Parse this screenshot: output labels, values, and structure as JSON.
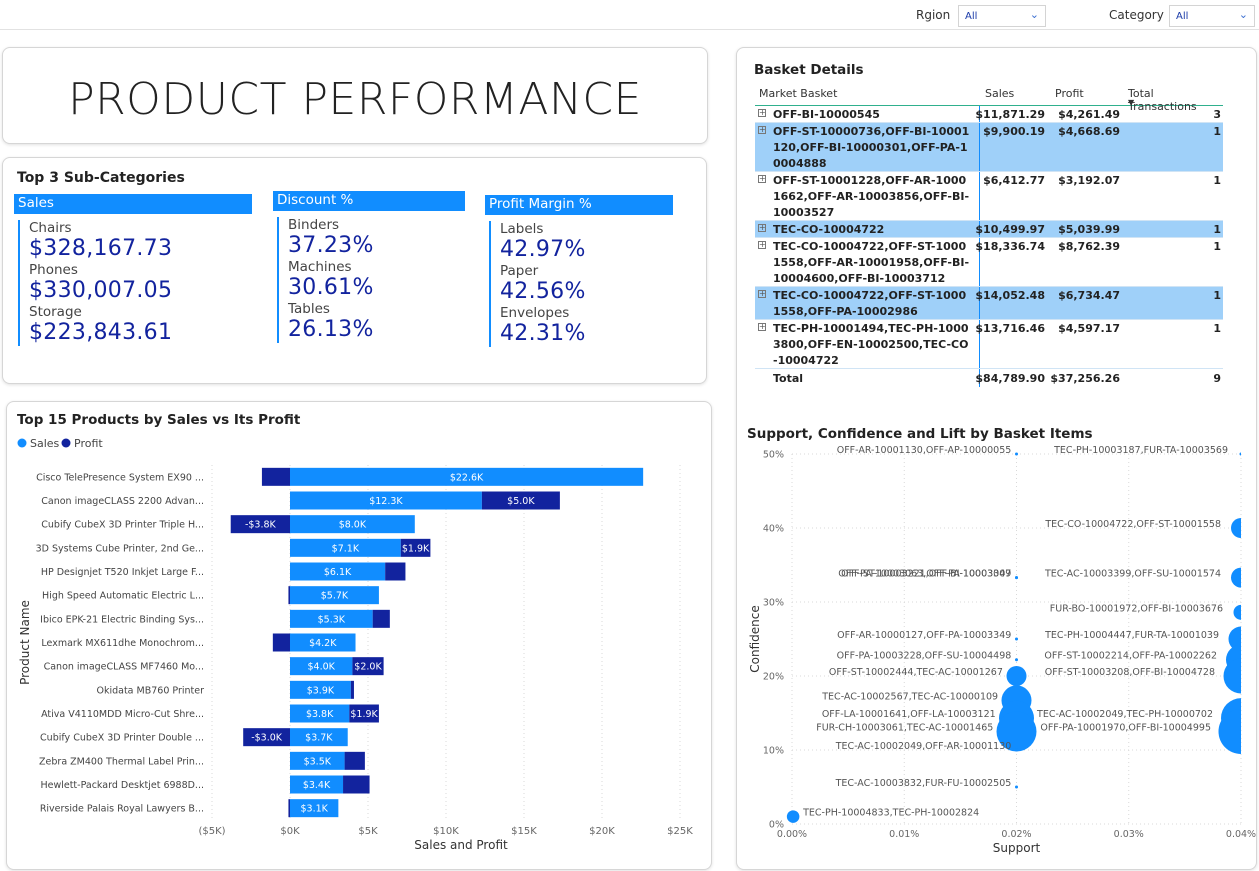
{
  "filters": {
    "region_label": "Rgion",
    "region_value": "All",
    "category_label": "Category",
    "category_value": "All"
  },
  "page_title": "PRODUCT PERFORMANCE",
  "subcategories": {
    "title": "Top 3 Sub-Categories",
    "columns": [
      {
        "header": "Sales",
        "items": [
          {
            "name": "Chairs",
            "value": "$328,167.73"
          },
          {
            "name": "Phones",
            "value": "$330,007.05"
          },
          {
            "name": "Storage",
            "value": "$223,843.61"
          }
        ]
      },
      {
        "header": "Discount %",
        "items": [
          {
            "name": "Binders",
            "value": "37.23%"
          },
          {
            "name": "Machines",
            "value": "30.61%"
          },
          {
            "name": "Tables",
            "value": "26.13%"
          }
        ]
      },
      {
        "header": "Profit Margin %",
        "items": [
          {
            "name": "Labels",
            "value": "42.97%"
          },
          {
            "name": "Paper",
            "value": "42.56%"
          },
          {
            "name": "Envelopes",
            "value": "42.31%"
          }
        ]
      }
    ]
  },
  "basket": {
    "title": "Basket Details",
    "headers": {
      "market_basket": "Market Basket",
      "sales": "Sales",
      "profit": "Profit",
      "transactions": "Total Transactions"
    },
    "rows": [
      {
        "basket": "OFF-BI-10000545",
        "sales": "$11,871.29",
        "profit": "$4,261.49",
        "transactions": "3",
        "highlight": false
      },
      {
        "basket": "OFF-ST-10000736,OFF-BI-10001120,OFF-BI-10000301,OFF-PA-10004888",
        "sales": "$9,900.19",
        "profit": "$4,668.69",
        "transactions": "1",
        "highlight": true
      },
      {
        "basket": "OFF-ST-10001228,OFF-AR-10001662,OFF-AR-10003856,OFF-BI-10003527",
        "sales": "$6,412.77",
        "profit": "$3,192.07",
        "transactions": "1",
        "highlight": false
      },
      {
        "basket": "TEC-CO-10004722",
        "sales": "$10,499.97",
        "profit": "$5,039.99",
        "transactions": "1",
        "highlight": true
      },
      {
        "basket": "TEC-CO-10004722,OFF-ST-10001558,OFF-AR-10001958,OFF-BI-10004600,OFF-BI-10003712",
        "sales": "$18,336.74",
        "profit": "$8,762.39",
        "transactions": "1",
        "highlight": false
      },
      {
        "basket": "TEC-CO-10004722,OFF-ST-10001558,OFF-PA-10002986",
        "sales": "$14,052.48",
        "profit": "$6,734.47",
        "transactions": "1",
        "highlight": true
      },
      {
        "basket": "TEC-PH-10001494,TEC-PH-10003800,OFF-EN-10002500,TEC-CO-10004722",
        "sales": "$13,716.46",
        "profit": "$4,597.17",
        "transactions": "1",
        "highlight": false
      }
    ],
    "total": {
      "label": "Total",
      "sales": "$84,789.90",
      "profit": "$37,256.26",
      "transactions": "9"
    }
  },
  "chart_data": [
    {
      "type": "bar",
      "title": "Top 15 Products by Sales vs Its Profit",
      "xlabel": "Sales and Profit",
      "ylabel": "Product Name",
      "orientation": "horizontal",
      "legend_position": "top-left",
      "grid": true,
      "xlim": [
        -5000,
        25000
      ],
      "x_ticks": [
        -5000,
        0,
        5000,
        10000,
        15000,
        20000,
        25000
      ],
      "x_tick_labels": [
        "($5K)",
        "$0K",
        "$5K",
        "$10K",
        "$15K",
        "$20K",
        "$25K"
      ],
      "categories": [
        "Cisco TelePresence System EX90 ...",
        "Canon imageCLASS 2200 Advan...",
        "Cubify CubeX 3D Printer Triple H...",
        "3D Systems Cube Printer, 2nd Ge...",
        "HP Designjet T520 Inkjet Large F...",
        "High Speed Automatic Electric L...",
        "Ibico EPK-21 Electric Binding Sys...",
        "Lexmark MX611dhe Monochrom...",
        "Canon imageCLASS MF7460 Mo...",
        "Okidata MB760 Printer",
        "Ativa V4110MDD Micro-Cut Shre...",
        "Cubify CubeX 3D Printer Double ...",
        "Zebra ZM400 Thermal Label Prin...",
        "Hewlett-Packard Desktjet 6988D...",
        "Riverside Palais Royal Lawyers B..."
      ],
      "series": [
        {
          "name": "Sales",
          "color": "#118dff",
          "values": [
            22638,
            12300,
            8000,
            7100,
            6100,
            5700,
            5300,
            4200,
            4000,
            3900,
            3800,
            3700,
            3500,
            3400,
            3100
          ],
          "labels": [
            "$22.6K",
            "$12.3K",
            "$8.0K",
            "$7.1K",
            "$6.1K",
            "$5.7K",
            "$5.3K",
            "$4.2K",
            "$4.0K",
            "$3.9K",
            "$3.8K",
            "$3.7K",
            "$3.5K",
            "$3.4K",
            "$3.1K"
          ]
        },
        {
          "name": "Profit",
          "color": "#12239e",
          "values": [
            -1800,
            5000,
            -3800,
            1900,
            1300,
            -100,
            1100,
            -1100,
            2000,
            200,
            1900,
            -3000,
            1300,
            1700,
            -100
          ],
          "labels": [
            "",
            "$5.0K",
            "-$3.8K",
            "$1.9K",
            "",
            "",
            "",
            "",
            "$2.0K",
            "",
            "$1.9K",
            "-$3.0K",
            "",
            "",
            ""
          ]
        }
      ]
    },
    {
      "type": "scatter",
      "title": "Support, Confidence and Lift by Basket Items",
      "xlabel": "Support",
      "ylabel": "Confidence",
      "xlim": [
        0,
        0.04
      ],
      "ylim": [
        0,
        50
      ],
      "x_tick_labels": [
        "0.00%",
        "0.01%",
        "0.02%",
        "0.03%",
        "0.04%"
      ],
      "y_tick_labels": [
        "0%",
        "10%",
        "20%",
        "30%",
        "40%",
        "50%"
      ],
      "grid": true,
      "points": [
        {
          "label": "OFF-AR-10001130,OFF-AP-10000055",
          "x": 0.02,
          "y": 50,
          "size": 1
        },
        {
          "label": "TEC-PH-10003187,FUR-TA-10003569",
          "x": 0.04,
          "y": 50,
          "size": 1
        },
        {
          "label": "TEC-CO-10004722,OFF-ST-10001558",
          "x": 0.04,
          "y": 40,
          "size": 8
        },
        {
          "label": "TEC-AC-10003399,OFF-SU-10001574",
          "x": 0.04,
          "y": 33.3,
          "size": 8
        },
        {
          "label": "OFF-PA-10003063,OFF-PA-10003349",
          "x": 0.02,
          "y": 33.3,
          "size": 1
        },
        {
          "label": "OFF-ST-10003221,OFF-BI-10003007",
          "x": 0.02,
          "y": 33.3,
          "size": 1
        },
        {
          "label": "FUR-BO-10001972,OFF-BI-10003676",
          "x": 0.04,
          "y": 28.6,
          "size": 6
        },
        {
          "label": "OFF-AR-10000127,OFF-PA-10003349",
          "x": 0.02,
          "y": 25,
          "size": 1
        },
        {
          "label": "TEC-PH-10004447,FUR-TA-10001039",
          "x": 0.04,
          "y": 25,
          "size": 10
        },
        {
          "label": "OFF-PA-10003228,OFF-SU-10004498",
          "x": 0.02,
          "y": 22.2,
          "size": 1
        },
        {
          "label": "OFF-ST-10002214,OFF-PA-10002262",
          "x": 0.04,
          "y": 22.2,
          "size": 12
        },
        {
          "label": "OFF-ST-10002444,TEC-AC-10001267",
          "x": 0.02,
          "y": 20,
          "size": 8
        },
        {
          "label": "OFF-ST-10003208,OFF-BI-10004728",
          "x": 0.04,
          "y": 20,
          "size": 14
        },
        {
          "label": "TEC-AC-10002567,TEC-AC-10000109",
          "x": 0.02,
          "y": 16.7,
          "size": 12
        },
        {
          "label": "OFF-LA-10001641,OFF-LA-10003121",
          "x": 0.02,
          "y": 14.3,
          "size": 14
        },
        {
          "label": "TEC-AC-10002049,TEC-PH-10000702",
          "x": 0.04,
          "y": 14.3,
          "size": 16
        },
        {
          "label": "FUR-CH-10003061,TEC-AC-10001465",
          "x": 0.02,
          "y": 12.5,
          "size": 16
        },
        {
          "label": "OFF-PA-10001970,OFF-BI-10004995",
          "x": 0.04,
          "y": 12.5,
          "size": 18
        },
        {
          "label": "TEC-AC-10002049,OFF-AR-10001130",
          "x": 0.02,
          "y": 10,
          "size": 1
        },
        {
          "label": "TEC-AC-10003832,FUR-FU-10002505",
          "x": 0.02,
          "y": 5,
          "size": 1
        },
        {
          "label": "TEC-PH-10004833,TEC-PH-10002824",
          "x": 0.0001,
          "y": 1,
          "size": 5
        }
      ]
    }
  ]
}
